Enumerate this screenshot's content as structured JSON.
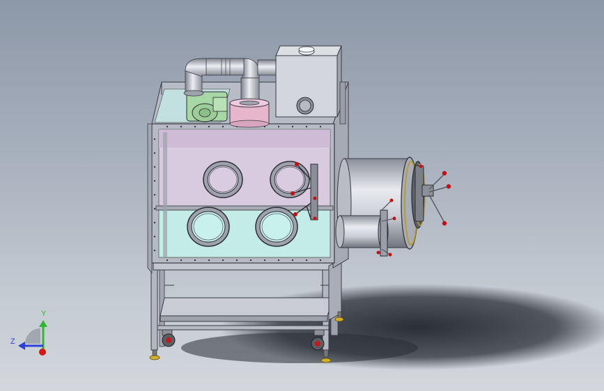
{
  "triad": {
    "y_label": "Y",
    "z_label": "Z",
    "y_color": "#2fb82f",
    "z_color": "#2d3fd8",
    "x_color": "#d01818"
  },
  "colors": {
    "frame": "#b3b7c2",
    "frame_edge": "#3a3a44",
    "glass_pink": "#d6c6dc",
    "glass_cyan": "#c2e9e5",
    "blower_green": "#a9d8a6",
    "filter_pink": "#e6b6cc",
    "bolt_red": "#c41010",
    "brass": "#b59a3c",
    "shadow": "#2a2e36"
  }
}
